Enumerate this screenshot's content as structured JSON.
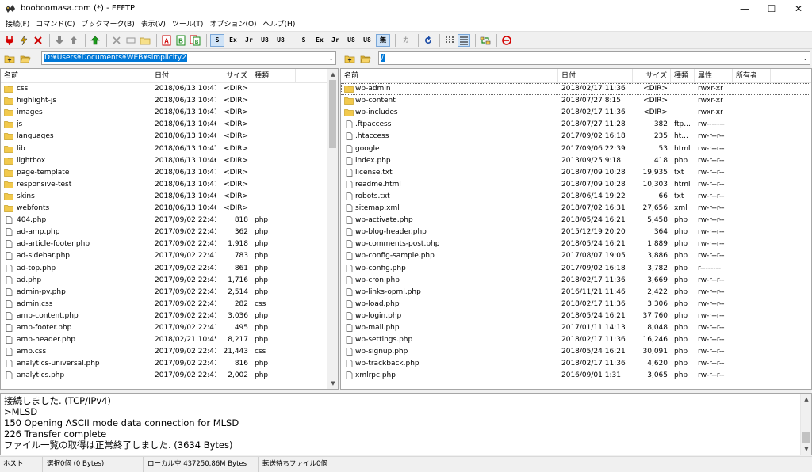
{
  "window": {
    "title": "booboomasa.com (*) - FFFTP",
    "min_icon": "minimize-icon",
    "max_icon": "maximize-icon",
    "close_icon": "close-icon"
  },
  "menu": [
    "接続(F)",
    "コマンド(C)",
    "ブックマーク(B)",
    "表示(V)",
    "ツール(T)",
    "オプション(O)",
    "ヘルプ(H)"
  ],
  "toolbar": {
    "mode_labels": [
      "S",
      "Ex",
      "Jr",
      "U8",
      "U8",
      "S",
      "Ex",
      "Jr",
      "U8",
      "U8",
      "無",
      "カ"
    ]
  },
  "local": {
    "path": "D:¥Users¥Documents¥WEB¥simplicity2",
    "columns": [
      "名前",
      "日付",
      "サイズ",
      "種類"
    ],
    "files": [
      {
        "name": "css",
        "date": "2018/06/13 10:47",
        "size": "<DIR>",
        "type": "",
        "dir": true
      },
      {
        "name": "highlight-js",
        "date": "2018/06/13 10:47",
        "size": "<DIR>",
        "type": "",
        "dir": true
      },
      {
        "name": "images",
        "date": "2018/06/13 10:47",
        "size": "<DIR>",
        "type": "",
        "dir": true
      },
      {
        "name": "js",
        "date": "2018/06/13 10:46",
        "size": "<DIR>",
        "type": "",
        "dir": true
      },
      {
        "name": "languages",
        "date": "2018/06/13 10:46",
        "size": "<DIR>",
        "type": "",
        "dir": true
      },
      {
        "name": "lib",
        "date": "2018/06/13 10:47",
        "size": "<DIR>",
        "type": "",
        "dir": true
      },
      {
        "name": "lightbox",
        "date": "2018/06/13 10:46",
        "size": "<DIR>",
        "type": "",
        "dir": true
      },
      {
        "name": "page-template",
        "date": "2018/06/13 10:47",
        "size": "<DIR>",
        "type": "",
        "dir": true
      },
      {
        "name": "responsive-test",
        "date": "2018/06/13 10:47",
        "size": "<DIR>",
        "type": "",
        "dir": true
      },
      {
        "name": "skins",
        "date": "2018/06/13 10:46",
        "size": "<DIR>",
        "type": "",
        "dir": true
      },
      {
        "name": "webfonts",
        "date": "2018/06/13 10:46",
        "size": "<DIR>",
        "type": "",
        "dir": true
      },
      {
        "name": "404.php",
        "date": "2017/09/02 22:41",
        "size": "818",
        "type": "php",
        "dir": false
      },
      {
        "name": "ad-amp.php",
        "date": "2017/09/02 22:41",
        "size": "362",
        "type": "php",
        "dir": false
      },
      {
        "name": "ad-article-footer.php",
        "date": "2017/09/02 22:41",
        "size": "1,918",
        "type": "php",
        "dir": false
      },
      {
        "name": "ad-sidebar.php",
        "date": "2017/09/02 22:41",
        "size": "783",
        "type": "php",
        "dir": false
      },
      {
        "name": "ad-top.php",
        "date": "2017/09/02 22:41",
        "size": "861",
        "type": "php",
        "dir": false
      },
      {
        "name": "ad.php",
        "date": "2017/09/02 22:41",
        "size": "1,716",
        "type": "php",
        "dir": false
      },
      {
        "name": "admin-pv.php",
        "date": "2017/09/02 22:41",
        "size": "2,514",
        "type": "php",
        "dir": false
      },
      {
        "name": "admin.css",
        "date": "2017/09/02 22:41",
        "size": "282",
        "type": "css",
        "dir": false
      },
      {
        "name": "amp-content.php",
        "date": "2017/09/02 22:41",
        "size": "3,036",
        "type": "php",
        "dir": false
      },
      {
        "name": "amp-footer.php",
        "date": "2017/09/02 22:41",
        "size": "495",
        "type": "php",
        "dir": false
      },
      {
        "name": "amp-header.php",
        "date": "2018/02/21 10:45",
        "size": "8,217",
        "type": "php",
        "dir": false
      },
      {
        "name": "amp.css",
        "date": "2017/09/02 22:41",
        "size": "21,443",
        "type": "css",
        "dir": false
      },
      {
        "name": "analytics-universal.php",
        "date": "2017/09/02 22:41",
        "size": "816",
        "type": "php",
        "dir": false
      },
      {
        "name": "analytics.php",
        "date": "2017/09/02 22:41",
        "size": "2,002",
        "type": "php",
        "dir": false
      }
    ]
  },
  "remote": {
    "path": "/",
    "columns": [
      "名前",
      "日付",
      "サイズ",
      "種類",
      "属性",
      "所有者"
    ],
    "files": [
      {
        "name": "wp-admin",
        "date": "2018/02/17 11:36",
        "size": "<DIR>",
        "type": "",
        "attr": "rwxr-xr",
        "dir": true
      },
      {
        "name": "wp-content",
        "date": "2018/07/27 8:15",
        "size": "<DIR>",
        "type": "",
        "attr": "rwxr-xr",
        "dir": true
      },
      {
        "name": "wp-includes",
        "date": "2018/02/17 11:36",
        "size": "<DIR>",
        "type": "",
        "attr": "rwxr-xr",
        "dir": true
      },
      {
        "name": ".ftpaccess",
        "date": "2018/07/27 11:28",
        "size": "382",
        "type": "ftp...",
        "attr": "rw-------",
        "dir": false
      },
      {
        "name": ".htaccess",
        "date": "2017/09/02 16:18",
        "size": "235",
        "type": "ht...",
        "attr": "rw-r--r--",
        "dir": false
      },
      {
        "name": "google",
        "date": "2017/09/06 22:39",
        "size": "53",
        "type": "html",
        "attr": "rw-r--r--",
        "dir": false
      },
      {
        "name": "index.php",
        "date": "2013/09/25 9:18",
        "size": "418",
        "type": "php",
        "attr": "rw-r--r--",
        "dir": false
      },
      {
        "name": "license.txt",
        "date": "2018/07/09 10:28",
        "size": "19,935",
        "type": "txt",
        "attr": "rw-r--r--",
        "dir": false
      },
      {
        "name": "readme.html",
        "date": "2018/07/09 10:28",
        "size": "10,303",
        "type": "html",
        "attr": "rw-r--r--",
        "dir": false
      },
      {
        "name": "robots.txt",
        "date": "2018/06/14 19:22",
        "size": "66",
        "type": "txt",
        "attr": "rw-r--r--",
        "dir": false
      },
      {
        "name": "sitemap.xml",
        "date": "2018/07/02 16:31",
        "size": "27,656",
        "type": "xml",
        "attr": "rw-r--r--",
        "dir": false
      },
      {
        "name": "wp-activate.php",
        "date": "2018/05/24 16:21",
        "size": "5,458",
        "type": "php",
        "attr": "rw-r--r--",
        "dir": false
      },
      {
        "name": "wp-blog-header.php",
        "date": "2015/12/19 20:20",
        "size": "364",
        "type": "php",
        "attr": "rw-r--r--",
        "dir": false
      },
      {
        "name": "wp-comments-post.php",
        "date": "2018/05/24 16:21",
        "size": "1,889",
        "type": "php",
        "attr": "rw-r--r--",
        "dir": false
      },
      {
        "name": "wp-config-sample.php",
        "date": "2017/08/07 19:05",
        "size": "3,886",
        "type": "php",
        "attr": "rw-r--r--",
        "dir": false
      },
      {
        "name": "wp-config.php",
        "date": "2017/09/02 16:18",
        "size": "3,782",
        "type": "php",
        "attr": "r--------",
        "dir": false
      },
      {
        "name": "wp-cron.php",
        "date": "2018/02/17 11:36",
        "size": "3,669",
        "type": "php",
        "attr": "rw-r--r--",
        "dir": false
      },
      {
        "name": "wp-links-opml.php",
        "date": "2016/11/21 11:46",
        "size": "2,422",
        "type": "php",
        "attr": "rw-r--r--",
        "dir": false
      },
      {
        "name": "wp-load.php",
        "date": "2018/02/17 11:36",
        "size": "3,306",
        "type": "php",
        "attr": "rw-r--r--",
        "dir": false
      },
      {
        "name": "wp-login.php",
        "date": "2018/05/24 16:21",
        "size": "37,760",
        "type": "php",
        "attr": "rw-r--r--",
        "dir": false
      },
      {
        "name": "wp-mail.php",
        "date": "2017/01/11 14:13",
        "size": "8,048",
        "type": "php",
        "attr": "rw-r--r--",
        "dir": false
      },
      {
        "name": "wp-settings.php",
        "date": "2018/02/17 11:36",
        "size": "16,246",
        "type": "php",
        "attr": "rw-r--r--",
        "dir": false
      },
      {
        "name": "wp-signup.php",
        "date": "2018/05/24 16:21",
        "size": "30,091",
        "type": "php",
        "attr": "rw-r--r--",
        "dir": false
      },
      {
        "name": "wp-trackback.php",
        "date": "2018/02/17 11:36",
        "size": "4,620",
        "type": "php",
        "attr": "rw-r--r--",
        "dir": false
      },
      {
        "name": "xmlrpc.php",
        "date": "2016/09/01 1:31",
        "size": "3,065",
        "type": "php",
        "attr": "rw-r--r--",
        "dir": false
      }
    ]
  },
  "log": [
    "接続しました. (TCP/IPv4)",
    ">MLSD",
    "150 Opening ASCII mode data connection for MLSD",
    "226 Transfer complete",
    "ファイル一覧の取得は正常終了しました. (3634 Bytes)"
  ],
  "status": [
    "ホスト",
    "選択0個 (0 Bytes)",
    "ローカル空 437250.86M Bytes",
    "転送待ちファイル0個"
  ],
  "colors": {
    "selection": "#0078d7",
    "folder": "#f2c94c",
    "folder_edge": "#c9a227"
  }
}
